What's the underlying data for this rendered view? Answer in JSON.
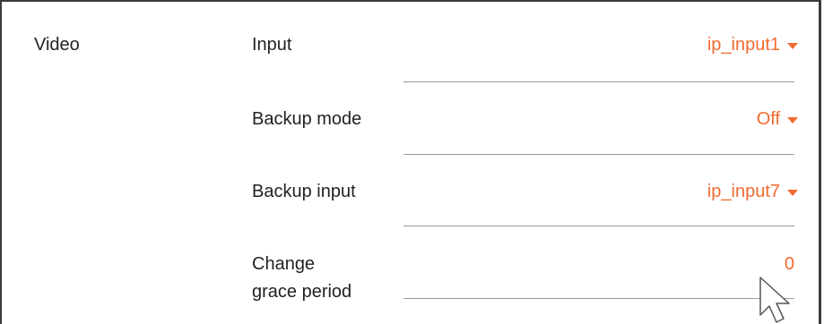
{
  "section": {
    "label": "Video"
  },
  "rows": [
    {
      "label": "Input",
      "value": "ip_input1",
      "control": "dropdown"
    },
    {
      "label": "Backup mode",
      "value": "Off",
      "control": "dropdown"
    },
    {
      "label": "Backup input",
      "value": "ip_input7",
      "control": "dropdown"
    },
    {
      "label_line1": "Change",
      "label_line2": "grace period",
      "value": "0",
      "control": "number"
    }
  ],
  "colors": {
    "accent": "#f26a30",
    "text": "#222222",
    "border": "#3c3c3c",
    "divider": "#9a9a9a"
  },
  "icons": {
    "dropdown": "caret-down-icon",
    "pointer": "mouse-pointer-icon"
  }
}
